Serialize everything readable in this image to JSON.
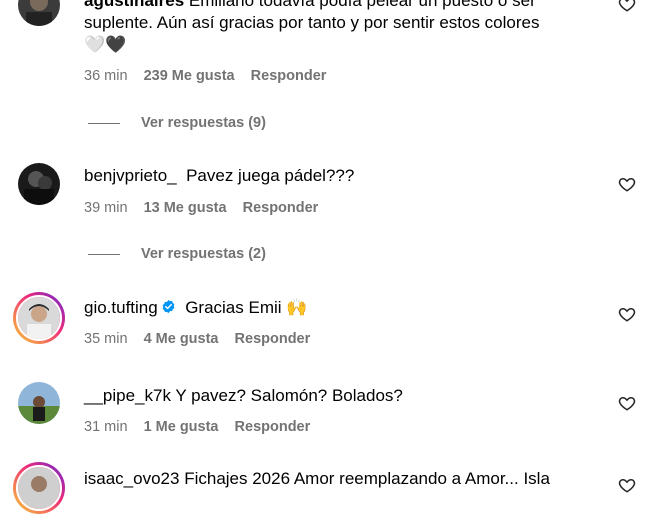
{
  "comments": [
    {
      "username": "agustinalres",
      "text_line1": "Emiliano todavía podía pelear un puesto o ser",
      "text_line2": "suplente. Aún así gracias por tanto y por sentir estos colores",
      "emojis": "🤍🖤",
      "time": "36 min",
      "likes": "239 Me gusta",
      "reply": "Responder",
      "view_replies": "Ver respuestas (9)"
    },
    {
      "username": "benjvprieto_",
      "text": "Pavez juega pádel???",
      "time": "39 min",
      "likes": "13 Me gusta",
      "reply": "Responder",
      "view_replies": "Ver respuestas (2)"
    },
    {
      "username": "gio.tufting",
      "verified": true,
      "text": "Gracias Emii",
      "emoji": "🙌",
      "time": "35 min",
      "likes": "4 Me gusta",
      "reply": "Responder"
    },
    {
      "username": "__pipe_k7k",
      "text": "Y pavez? Salomón? Bolados?",
      "time": "31 min",
      "likes": "1 Me gusta",
      "reply": "Responder"
    },
    {
      "username": "isaac_ovo23",
      "text": "Fichajes 2026 Amor reemplazando a Amor... Isla"
    }
  ],
  "colors": {
    "meta_text": "#737373",
    "verified_badge": "#0095f6",
    "story_ring": "#ee2a7b"
  },
  "icons": {
    "like": "heart-outline-icon",
    "verified": "verified-badge-icon"
  }
}
